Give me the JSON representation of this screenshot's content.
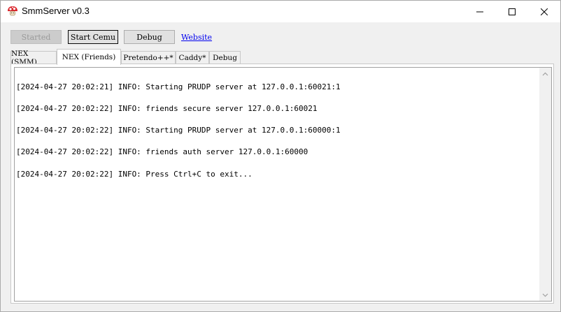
{
  "window": {
    "title": "SmmServer v0.3",
    "icon": "mushroom-icon",
    "controls": [
      "minimize-icon",
      "maximize-icon",
      "close-icon"
    ]
  },
  "toolbar": {
    "start_label": "Started",
    "start_enabled": false,
    "cemu_label": "Start Cemu",
    "debug_label": "Debug",
    "website_label": "Website"
  },
  "tabs": [
    {
      "label": "NEX (SMM)",
      "active": false
    },
    {
      "label": "NEX (Friends)",
      "active": true
    },
    {
      "label": "Pretendo++*",
      "active": false
    },
    {
      "label": "Caddy*",
      "active": false
    },
    {
      "label": "Debug",
      "active": false
    }
  ],
  "log": {
    "lines": [
      "[2024-04-27 20:02:21] INFO: Starting PRUDP server at 127.0.0.1:60021:1",
      "[2024-04-27 20:02:22] INFO: friends secure server 127.0.0.1:60021",
      "[2024-04-27 20:02:22] INFO: Starting PRUDP server at 127.0.0.1:60000:1",
      "[2024-04-27 20:02:22] INFO: friends auth server 127.0.0.1:60000",
      "[2024-04-27 20:02:22] INFO: Press Ctrl+C to exit..."
    ]
  },
  "colors": {
    "link": "#0000ee",
    "window_bg": "#f0f0f0",
    "icon_red": "#d9262c"
  }
}
